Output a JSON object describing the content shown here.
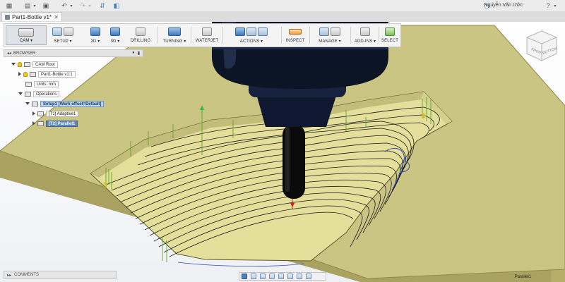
{
  "app": {
    "tab_title": "Part1-Bottle v1*",
    "user_name": "Nguyễn Văn Ước"
  },
  "toolbar": {
    "workspace": "CAM",
    "groups": [
      {
        "label": "SETUP",
        "dropdown": true
      },
      {
        "label": "2D",
        "dropdown": true
      },
      {
        "label": "3D",
        "dropdown": true
      },
      {
        "label": "DRILLING",
        "dropdown": false
      },
      {
        "label": "TURNING",
        "dropdown": true
      },
      {
        "label": "WATERJET",
        "dropdown": false
      },
      {
        "label": "ACTIONS",
        "dropdown": true
      },
      {
        "label": "INSPECT",
        "dropdown": false
      },
      {
        "label": "MANAGE",
        "dropdown": true
      },
      {
        "label": "ADD-INS",
        "dropdown": true
      },
      {
        "label": "SELECT",
        "dropdown": false
      }
    ]
  },
  "browser": {
    "title": "BROWSER",
    "tree": {
      "root": "CAM Root",
      "part": "Part1-Bottle v1:1",
      "units": "Units: mm",
      "operations": "Operations",
      "setup": "Setup1 [Work offset=Default]",
      "op1": "[T1] Adaptive1",
      "op2": "[T2] Parallel1"
    }
  },
  "comments": {
    "label": "COMMENTS"
  },
  "status": {
    "selection": "Parallel1"
  },
  "viewcube": {
    "front": "FRONT",
    "bottom": "BOTTOM"
  },
  "colors": {
    "stock_top": "#cbc584",
    "stock_side": "#a9a260",
    "pocket": "#e4df9a",
    "toolpath": "#1a1a1a",
    "spindle": "#0c1526",
    "accent": "#3f78bd"
  }
}
